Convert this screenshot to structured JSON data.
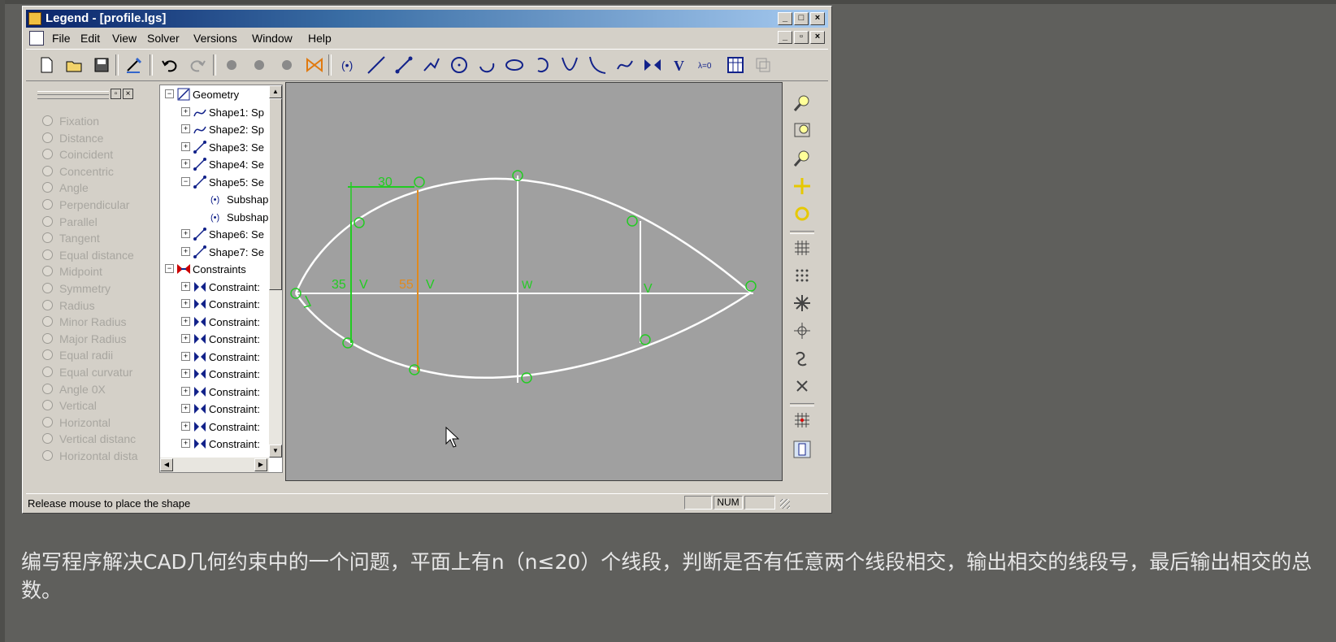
{
  "window": {
    "title": "Legend - [profile.lgs]",
    "title_buttons": [
      "_",
      "□",
      "×"
    ],
    "doc_buttons": [
      "_",
      "▫",
      "×"
    ]
  },
  "menu": {
    "items": [
      "File",
      "Edit",
      "View",
      "Solver",
      "Versions",
      "Window",
      "Help"
    ]
  },
  "toolbar": {
    "icons": [
      "new-file-icon",
      "open-folder-icon",
      "save-icon",
      "wand-icon",
      "undo-icon",
      "redo-icon",
      "point-icon",
      "point-icon",
      "point-icon",
      "bowtie-icon",
      "subshape-icon",
      "line-icon",
      "segment-icon",
      "polyline-icon",
      "circle-icon",
      "arc-icon",
      "ellipse-icon",
      "arc-ccw-icon",
      "parabola-icon",
      "hyperbola-icon",
      "spline-icon",
      "constraint-icon",
      "v-icon",
      "lambda-icon",
      "table-icon",
      "copy-icon"
    ],
    "v_label": "V",
    "lambda_label": "λ=0"
  },
  "constraints_panel": {
    "options": [
      "Fixation",
      "Distance",
      "Coincident",
      "Concentric",
      "Angle",
      "Perpendicular",
      "Parallel",
      "Tangent",
      "Equal distance",
      "Midpoint",
      "Symmetry",
      "Radius",
      "Minor Radius",
      "Major Radius",
      "Equal radii",
      "Equal curvatur",
      "Angle 0X",
      "Vertical",
      "Horizontal",
      "Vertical distanc",
      "Horizontal dista"
    ]
  },
  "tree": {
    "rows": [
      {
        "label": "Geometry",
        "expander": "−",
        "icon": "geometry-icon",
        "level": 0
      },
      {
        "label": "Shape1: Sp",
        "expander": "+",
        "icon": "spline-shape-icon",
        "level": 1
      },
      {
        "label": "Shape2: Sp",
        "expander": "+",
        "icon": "spline-shape-icon",
        "level": 1
      },
      {
        "label": "Shape3: Se",
        "expander": "+",
        "icon": "segment-shape-icon",
        "level": 1
      },
      {
        "label": "Shape4: Se",
        "expander": "+",
        "icon": "segment-shape-icon",
        "level": 1
      },
      {
        "label": "Shape5: Se",
        "expander": "−",
        "icon": "segment-shape-icon",
        "level": 1
      },
      {
        "label": "Subshap",
        "expander": "",
        "icon": "subshape-icon",
        "level": 2
      },
      {
        "label": "Subshap",
        "expander": "",
        "icon": "subshape-icon",
        "level": 2
      },
      {
        "label": "Shape6: Se",
        "expander": "+",
        "icon": "segment-shape-icon",
        "level": 1
      },
      {
        "label": "Shape7: Se",
        "expander": "+",
        "icon": "segment-shape-icon",
        "level": 1
      },
      {
        "label": "Constraints",
        "expander": "−",
        "icon": "constraints-icon",
        "level": 0
      },
      {
        "label": "Constraint:",
        "expander": "+",
        "icon": "constraint-icon",
        "level": 1
      },
      {
        "label": "Constraint:",
        "expander": "+",
        "icon": "constraint-icon",
        "level": 1
      },
      {
        "label": "Constraint:",
        "expander": "+",
        "icon": "constraint-icon",
        "level": 1
      },
      {
        "label": "Constraint:",
        "expander": "+",
        "icon": "constraint-icon",
        "level": 1
      },
      {
        "label": "Constraint:",
        "expander": "+",
        "icon": "constraint-icon",
        "level": 1
      },
      {
        "label": "Constraint:",
        "expander": "+",
        "icon": "constraint-icon",
        "level": 1
      },
      {
        "label": "Constraint:",
        "expander": "+",
        "icon": "constraint-icon",
        "level": 1
      },
      {
        "label": "Constraint:",
        "expander": "+",
        "icon": "constraint-icon",
        "level": 1
      },
      {
        "label": "Constraint:",
        "expander": "+",
        "icon": "constraint-icon",
        "level": 1
      },
      {
        "label": "Constraint:",
        "expander": "+",
        "icon": "constraint-icon",
        "level": 1
      }
    ]
  },
  "canvas": {
    "dimension_labels": {
      "top": "30",
      "left": "35",
      "mid": "55",
      "v1": "V",
      "v2": "V",
      "v3": "W",
      "v4": "V"
    },
    "colors": {
      "background": "#a0a0a0",
      "profile": "#ffffff",
      "constraint": "#22cc22",
      "highlight": "#e08a1e"
    }
  },
  "right_toolbar": {
    "icons": [
      "zoom-icon",
      "zoom-window-icon",
      "zoom-out-icon",
      "pan-icon",
      "fit-icon",
      "grid-icon",
      "dots-icon",
      "snap-icon",
      "snap-center-icon",
      "snap-curve-icon",
      "snap-point-icon",
      "grid-red-icon",
      "tree-toggle-icon"
    ]
  },
  "status": {
    "message": "Release mouse to place the shape",
    "num": "NUM"
  },
  "caption": "编写程序解决CAD几何约束中的一个问题，平面上有n（n≤20）个线段，判断是否有任意两个线段相交，输出相交的线段号，最后输出相交的总数。"
}
